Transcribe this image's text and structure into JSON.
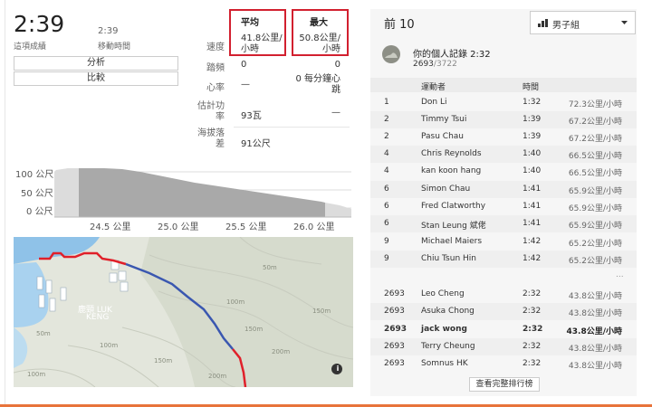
{
  "effort": {
    "elapsed_time": "2:39",
    "elapsed_label": "這項成績",
    "moving_time": "2:39",
    "moving_label": "移動時間",
    "analysis_button": "分析",
    "compare_button": "比較"
  },
  "stats": {
    "avg_header": "平均",
    "max_header": "最大",
    "rows": [
      {
        "label": "速度",
        "avg": "41.8公里/小時",
        "max": "50.8公里/小時"
      },
      {
        "label": "踏頻",
        "avg": "0",
        "max": "0"
      },
      {
        "label": "心率",
        "avg": "—",
        "max": "0 每分鐘心跳"
      },
      {
        "label": "估計功率",
        "avg": "93瓦",
        "max": "—"
      },
      {
        "label": "海拔落差",
        "avg": "91公尺",
        "max": ""
      }
    ]
  },
  "elevation_chart": {
    "y_labels": [
      "100 公尺",
      "50 公尺",
      "0 公尺"
    ],
    "x_labels": [
      "24.5 公里",
      "25.0 公里",
      "25.5 公里",
      "26.0 公里"
    ]
  },
  "map": {
    "place_label_1": "鹿頸 LUK",
    "place_label_2": "KENG",
    "contour_labels": [
      "50m",
      "100m",
      "150m",
      "200m",
      "50m",
      "100m",
      "150m",
      "200m",
      "100m",
      "150m"
    ],
    "info_icon": "i"
  },
  "leaderboard": {
    "title": "前 10",
    "filter": "男子組",
    "pr_label": "你的個人記錄 2:32",
    "pr_rank": "2693",
    "pr_total": "/3722",
    "col_athlete": "運動者",
    "col_time": "時間",
    "rows": [
      {
        "rank": "1",
        "name": "Don Li",
        "time": "1:32",
        "speed": "72.3公里/小時"
      },
      {
        "rank": "2",
        "name": "Timmy Tsui",
        "time": "1:39",
        "speed": "67.2公里/小時"
      },
      {
        "rank": "2",
        "name": "Pasu Chau",
        "time": "1:39",
        "speed": "67.2公里/小時"
      },
      {
        "rank": "4",
        "name": "Chris Reynolds",
        "time": "1:40",
        "speed": "66.5公里/小時"
      },
      {
        "rank": "4",
        "name": "kan koon hang",
        "time": "1:40",
        "speed": "66.5公里/小時"
      },
      {
        "rank": "6",
        "name": "Simon Chau",
        "time": "1:41",
        "speed": "65.9公里/小時"
      },
      {
        "rank": "6",
        "name": "Fred Clatworthy",
        "time": "1:41",
        "speed": "65.9公里/小時"
      },
      {
        "rank": "6",
        "name": "Stan Leung 斌佬",
        "time": "1:41",
        "speed": "65.9公里/小時"
      },
      {
        "rank": "9",
        "name": "Michael Maiers",
        "time": "1:42",
        "speed": "65.2公里/小時"
      },
      {
        "rank": "9",
        "name": "Chiu Tsun Hin",
        "time": "1:42",
        "speed": "65.2公里/小時"
      }
    ],
    "ellipsis": "...",
    "nearby": [
      {
        "rank": "2693",
        "name": "Leo Cheng",
        "time": "2:32",
        "speed": "43.8公里/小時"
      },
      {
        "rank": "2693",
        "name": "Asuka Chong",
        "time": "2:32",
        "speed": "43.8公里/小時"
      },
      {
        "rank": "2693",
        "name": "jack wong",
        "time": "2:32",
        "speed": "43.8公里/小時"
      },
      {
        "rank": "2693",
        "name": "Terry Cheung",
        "time": "2:32",
        "speed": "43.8公里/小時"
      },
      {
        "rank": "2693",
        "name": "Somnus HK",
        "time": "2:32",
        "speed": "43.8公里/小時"
      }
    ],
    "view_full": "查看完整排行榜"
  }
}
